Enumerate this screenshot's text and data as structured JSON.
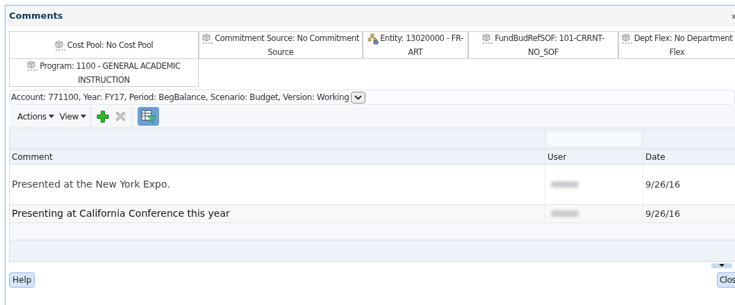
{
  "dialog": {
    "title": "Comments"
  },
  "pov": [
    {
      "label": "Cost Pool: No Cost Pool",
      "kind": "member"
    },
    {
      "label": "Commitment Source: No Commitment Source",
      "kind": "member"
    },
    {
      "label": "Entity: 13020000 - FR-ART",
      "kind": "hierarchy"
    },
    {
      "label": "FundBudRefSOF: 101-CRRNT-NO_SOF",
      "kind": "member"
    },
    {
      "label": "Dept Flex: No Department Flex",
      "kind": "member"
    },
    {
      "label": "Program: 1100 - GENERAL ACADEMIC INSTRUCTION",
      "kind": "member"
    }
  ],
  "context": {
    "value": "Account: 771100, Year: FY17, Period: BegBalance, Scenario: Budget, Version: Working"
  },
  "toolbar": {
    "menus": [
      "Actions",
      "View"
    ]
  },
  "table": {
    "columns": [
      "Comment",
      "User",
      "Date"
    ],
    "rows": [
      {
        "comment": "Presented at the New York Expo.",
        "date": "9/26/16",
        "tall": true
      },
      {
        "comment": "Presenting at California Conference this year",
        "date": "9/26/16",
        "tall": false
      }
    ]
  },
  "buttons": {
    "help": "Help",
    "close": "Clos"
  }
}
